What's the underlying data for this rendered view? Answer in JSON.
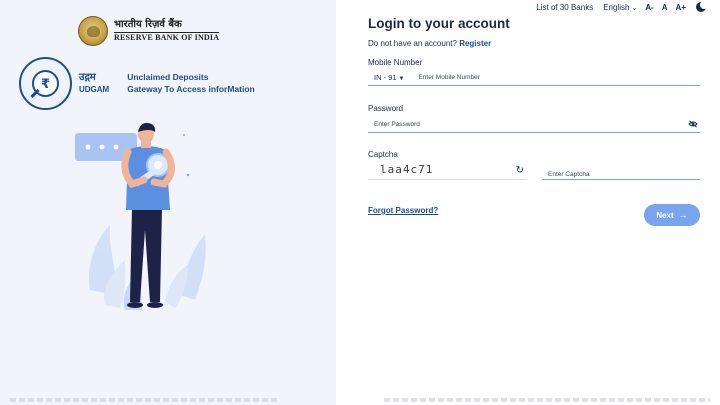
{
  "branding": {
    "rbi_hindi": "भारतीय रिज़र्व बैंक",
    "rbi_english": "RESERVE BANK OF INDIA",
    "rupee_symbol": "₹",
    "udgam_hindi": "उद्गम",
    "udgam_english": "UDGAM",
    "tagline_line1": "Unclaimed Deposits",
    "tagline_line2": "Gateway To Access inforMation"
  },
  "topbar": {
    "banks_link": "List of 30 Banks",
    "language": "English",
    "font_decrease": "A-",
    "font_normal": "A",
    "font_increase": "A+"
  },
  "form": {
    "title": "Login to your account",
    "no_account_text": "Do not have an account?",
    "register_link": "Register",
    "mobile_label": "Mobile Number",
    "country_code": "IN - 91",
    "mobile_placeholder": "Enter Mobile Number",
    "password_label": "Password",
    "password_placeholder": "Enter Password",
    "captcha_label": "Captcha",
    "captcha_value": "laa4c71",
    "captcha_placeholder": "Enter Captcha",
    "forgot_password": "Forgot Password?",
    "next_button": "Next"
  },
  "colors": {
    "brand_navy": "#1e4d8f",
    "accent_blue": "#79a4ee",
    "left_panel_bg": "#f1f4fa"
  },
  "icons": {
    "caret": "caret-down-icon",
    "eye": "eye-off-icon",
    "refresh": "refresh-icon",
    "theme": "moon-icon",
    "arrow": "arrow-right-icon"
  }
}
